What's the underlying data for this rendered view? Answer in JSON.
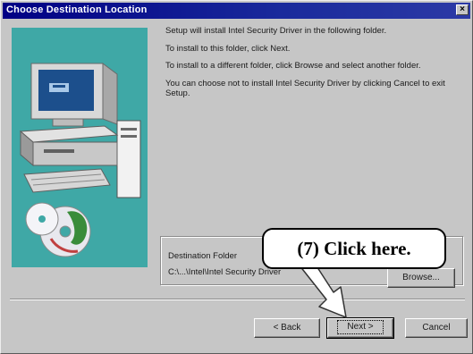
{
  "window": {
    "title": "Choose Destination Location",
    "close_glyph": "×"
  },
  "body": {
    "para1": "Setup will install Intel Security Driver in the following folder.",
    "para2": "To install to this folder, click Next.",
    "para3": "To install to a different folder, click Browse and select another folder.",
    "para4": "You can choose not to install Intel Security Driver by clicking Cancel to exit Setup."
  },
  "destination": {
    "label": "Destination Folder",
    "path": "C:\\...\\Intel\\Intel Security Driver",
    "browse_label": "Browse..."
  },
  "buttons": {
    "back_label": "< Back",
    "next_label": "Next >",
    "cancel_label": "Cancel"
  },
  "annotation": {
    "text": "(7)  Click here."
  },
  "colors": {
    "title_bar": "#000084",
    "dialog_bg": "#c6c6c6",
    "art_bg": "#3fa8a6"
  },
  "icons": {
    "art": "computer-with-cds-illustration",
    "close": "close-icon",
    "arrow": "callout-arrow-icon"
  }
}
